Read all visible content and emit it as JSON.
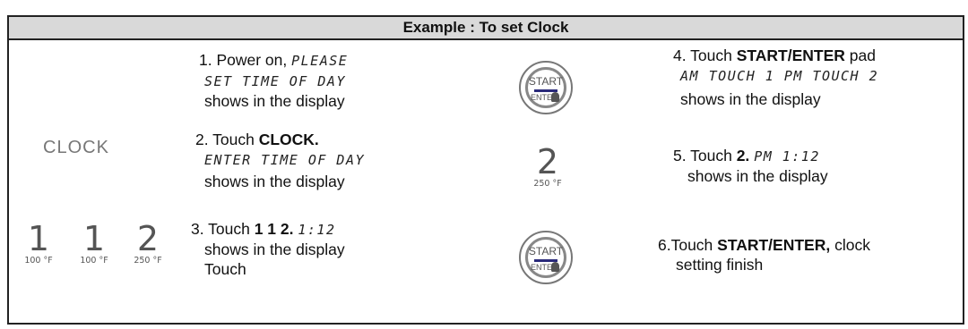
{
  "header": {
    "title": "Example  : To set Clock"
  },
  "left": {
    "clock_label": "CLOCK",
    "digits": [
      {
        "digit": "1",
        "temp": "100 °F"
      },
      {
        "digit": "1",
        "temp": "100 °F"
      },
      {
        "digit": "2",
        "temp": "250 °F"
      }
    ]
  },
  "middle_icons": {
    "start_label": "START",
    "enter_label": "ENTER",
    "digit": "2",
    "digit_temp": "250 °F"
  },
  "steps": {
    "s1": {
      "prefix": "1. Power on, ",
      "lcd1": "PLEASE",
      "lcd2": "SET TIME OF DAY",
      "suffix": "shows in the display"
    },
    "s2": {
      "prefix": "2. Touch ",
      "bold": "CLOCK.",
      "lcd": "ENTER TIME OF DAY",
      "suffix": "shows in the display"
    },
    "s3": {
      "prefix": "3. Touch ",
      "bold": "1 1 2.",
      "lcd": "1:12",
      "line2": "shows in the display",
      "line3": "Touch"
    },
    "s4": {
      "prefix": "4. Touch ",
      "bold": "START/ENTER",
      "after": " pad",
      "lcd": "AM TOUCH 1 PM TOUCH 2",
      "suffix": "shows in the display"
    },
    "s5": {
      "prefix": "5. Touch ",
      "bold": "2.",
      "lcd": "PM 1:12",
      "suffix": "shows in the display"
    },
    "s6": {
      "prefix": "6.Touch ",
      "bold": "START/ENTER,",
      "after": " clock",
      "line2": "setting finish"
    }
  }
}
